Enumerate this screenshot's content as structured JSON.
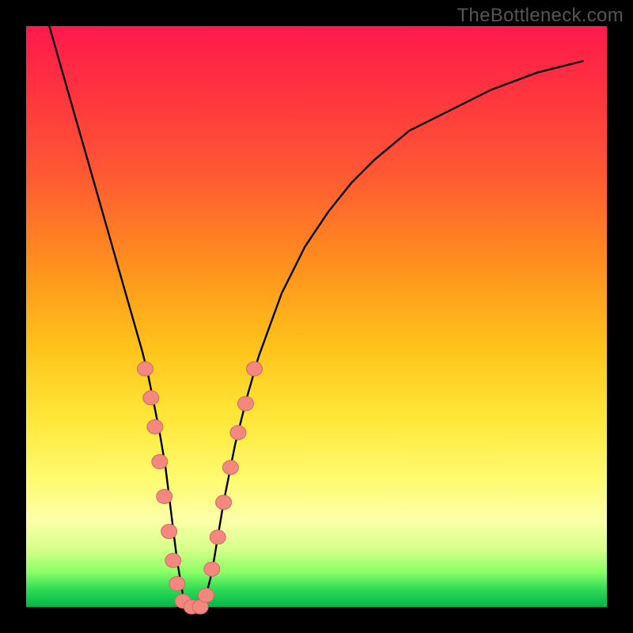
{
  "watermark": "TheBottleneck.com",
  "colors": {
    "frame": "#000000",
    "gradient_top": "#ff1a4d",
    "gradient_bottom": "#00b74a",
    "curve": "#000000",
    "marker_fill": "#f4887e",
    "marker_stroke": "#ce6b63"
  },
  "chart_data": {
    "type": "line",
    "title": "",
    "xlabel": "",
    "ylabel": "",
    "xlim": [
      0,
      100
    ],
    "ylim": [
      0,
      100
    ],
    "note": "V-shaped bottleneck curve; y≈0 is optimal (green). Values estimated from pixel positions.",
    "series": [
      {
        "name": "bottleneck-curve",
        "x": [
          4,
          6,
          8,
          10,
          12,
          14,
          16,
          18,
          20,
          21,
          22,
          23,
          24,
          25,
          26,
          27,
          28,
          29,
          30,
          31,
          32,
          33,
          34,
          36,
          38,
          40,
          44,
          48,
          52,
          56,
          60,
          66,
          72,
          80,
          88,
          96
        ],
        "y": [
          100,
          93,
          86,
          79,
          72,
          65,
          58,
          51,
          44,
          40,
          35,
          30,
          24,
          16,
          8,
          2,
          0,
          0,
          0,
          2,
          6,
          12,
          18,
          28,
          36,
          43,
          54,
          62,
          68,
          73,
          77,
          82,
          85,
          89,
          92,
          94
        ]
      }
    ],
    "markers": {
      "name": "highlighted-points",
      "points": [
        {
          "x": 20.5,
          "y": 41
        },
        {
          "x": 21.5,
          "y": 36
        },
        {
          "x": 22.2,
          "y": 31
        },
        {
          "x": 23.0,
          "y": 25
        },
        {
          "x": 23.8,
          "y": 19
        },
        {
          "x": 24.6,
          "y": 13
        },
        {
          "x": 25.3,
          "y": 8
        },
        {
          "x": 26.0,
          "y": 4
        },
        {
          "x": 27.0,
          "y": 1
        },
        {
          "x": 28.5,
          "y": 0
        },
        {
          "x": 30.0,
          "y": 0
        },
        {
          "x": 31.0,
          "y": 2
        },
        {
          "x": 32.0,
          "y": 6.5
        },
        {
          "x": 33.0,
          "y": 12
        },
        {
          "x": 34.0,
          "y": 18
        },
        {
          "x": 35.2,
          "y": 24
        },
        {
          "x": 36.5,
          "y": 30
        },
        {
          "x": 37.8,
          "y": 35
        },
        {
          "x": 39.3,
          "y": 41
        }
      ]
    }
  }
}
